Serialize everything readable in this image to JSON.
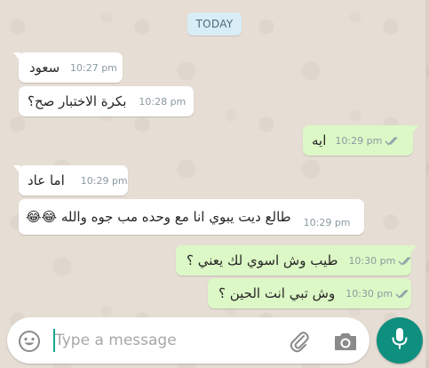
{
  "chat": {
    "date_label": "TODAY",
    "messages": [
      {
        "direction": "in",
        "text": "سعود",
        "time": "10:27 pm"
      },
      {
        "direction": "in",
        "text": "بكرة الاختبار صح؟",
        "time": "10:28 pm"
      },
      {
        "direction": "out",
        "text": "ايه",
        "time": "10:29 pm",
        "status": "read"
      },
      {
        "direction": "in",
        "text": "اما عاد",
        "time": "10:29 pm"
      },
      {
        "direction": "in",
        "text": "طالع ديت يبوي انا مع وحده مب جوه والله 😂😂",
        "time": "10:29 pm"
      },
      {
        "direction": "out",
        "text": "طيب وش اسوي لك يعني ؟",
        "time": "10:30 pm",
        "status": "read"
      },
      {
        "direction": "out",
        "text": "وش تبي انت الحين ؟",
        "time": "10:30 pm",
        "status": "read"
      }
    ]
  },
  "composer": {
    "placeholder": "Type a message",
    "value": ""
  },
  "icons": {
    "emoji": "smiley-icon",
    "attach": "paperclip-icon",
    "camera": "camera-icon",
    "mic": "microphone-icon",
    "read_receipt": "double-check-icon"
  },
  "colors": {
    "incoming_bubble": "#ffffff",
    "outgoing_bubble": "#dcf8c6",
    "mic_button": "#0f8f7e",
    "date_chip": "#d9edf7"
  }
}
